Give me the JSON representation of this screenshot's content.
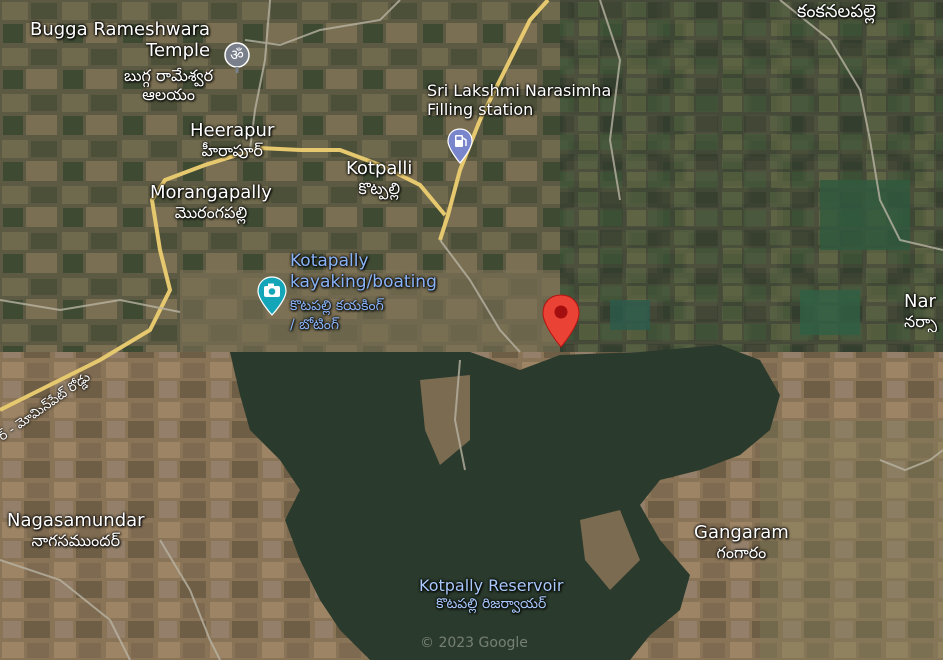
{
  "places": {
    "bugga_temple": {
      "en_line1": "Bugga Rameshwara",
      "en_line2": "Temple",
      "te_line1": "బుగ్గ రామేశ్వర",
      "te_line2": "ఆలయం"
    },
    "heerapur": {
      "en": "Heerapur",
      "te": "హీరాపూర్"
    },
    "morangapally": {
      "en": "Morangapally",
      "te": "మొరంగపల్లి"
    },
    "kotpalli": {
      "en": "Kotpalli",
      "te": "కొట్పల్లి"
    },
    "filling_station": {
      "en_line1": "Sri Lakshmi Narasimha",
      "en_line2": "Filling station"
    },
    "kankanalapalle": {
      "te": "కంకనలపల్లె"
    },
    "kayaking": {
      "en_line1": "Kotapally",
      "en_line2": "kayaking/boating",
      "te_line1": "కొటపల్లి కయకింగ్",
      "te_line2": "/ బోటింగ్"
    },
    "nar": {
      "en": "Nar",
      "te": "నర్సా"
    },
    "nagasamundar": {
      "en": "Nagasamundar",
      "te": "నాగసముందర్"
    },
    "gangaram": {
      "en": "Gangaram",
      "te": "గంగారం"
    },
    "reservoir": {
      "en": "Kotpally Reservoir",
      "te": "కొటపల్లి రిజర్వాయర్"
    }
  },
  "road_label": "ర్ - మోమిన్‌పేట్ రోడ్డు",
  "copyright": "© 2023 Google",
  "icons": {
    "temple": "om-icon",
    "fuel": "fuel-pump-icon",
    "camera": "camera-icon",
    "pin": "map-pin-icon"
  },
  "colors": {
    "pin_red": "#ea4335",
    "poi_blue": "#8ab4f8",
    "road_yellow": "#e6c86e",
    "water": "#2a3a2c"
  }
}
